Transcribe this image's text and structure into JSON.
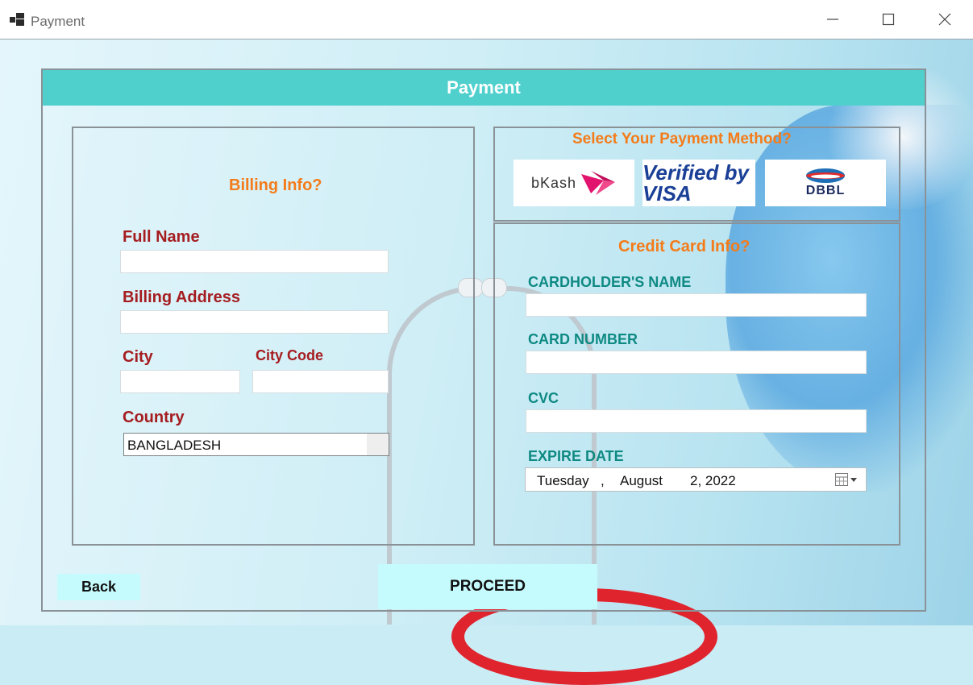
{
  "window": {
    "title": "Payment",
    "minimize": "—",
    "maximize": "☐",
    "close": "✕"
  },
  "header": {
    "title": "Payment"
  },
  "billing": {
    "heading": "Billing Info?",
    "full_name_label": "Full Name",
    "full_name_value": "",
    "address_label": "Billing Address",
    "address_value": "",
    "city_label": "City",
    "city_value": "",
    "city_code_label": "City Code",
    "city_code_value": "",
    "country_label": "Country",
    "country_value": "BANGLADESH"
  },
  "payment_method": {
    "heading": "Select Your Payment Method?",
    "options": [
      "bKash",
      "Verified by VISA",
      "DBBL"
    ]
  },
  "credit_card": {
    "heading": "Credit Card Info?",
    "holder_label": "CARDHOLDER'S NAME",
    "holder_value": "",
    "number_label": "CARD NUMBER",
    "number_value": "",
    "cvc_label": "CVC",
    "cvc_value": "",
    "expire_label": "EXPIRE DATE",
    "expire_weekday": "Tuesday",
    "expire_sep": ",",
    "expire_month": "August",
    "expire_daynum": "2, 2022"
  },
  "buttons": {
    "back": "Back",
    "proceed": "PROCEED"
  },
  "icons": {
    "calendar": "calendar-icon",
    "dropdown": "chevron-down-icon"
  }
}
